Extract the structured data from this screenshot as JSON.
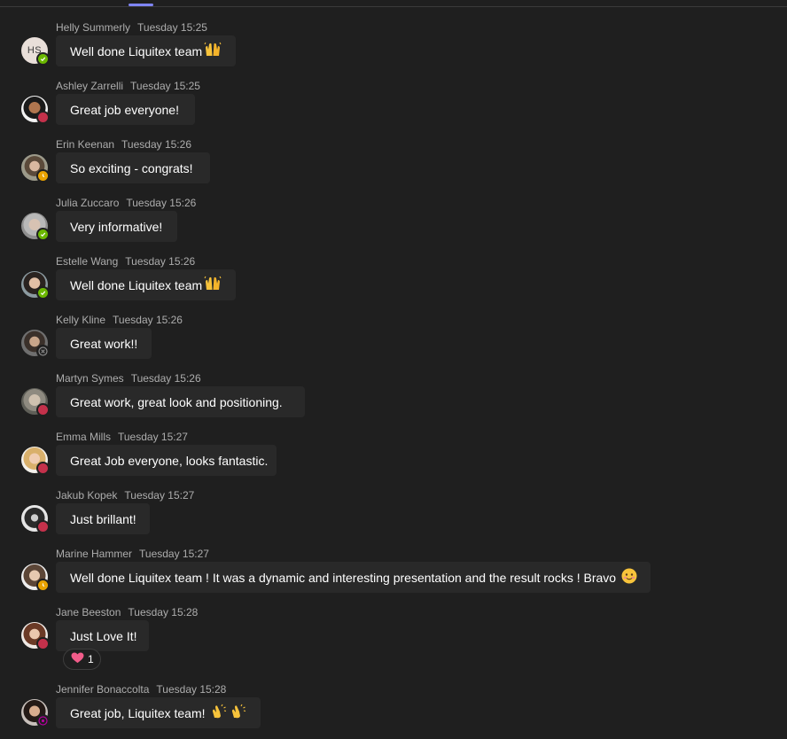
{
  "messages": [
    {
      "author": "Helly Summerly",
      "time": "Tuesday 15:25",
      "text": "Well done Liquitex team",
      "avatar_initials": "HS",
      "presence": "available"
    },
    {
      "author": "Ashley Zarrelli",
      "time": "Tuesday 15:25",
      "text": "Great job everyone!",
      "presence": "busy"
    },
    {
      "author": "Erin Keenan",
      "time": "Tuesday 15:26",
      "text": "So exciting - congrats!",
      "presence": "away"
    },
    {
      "author": "Julia Zuccaro",
      "time": "Tuesday 15:26",
      "text": "Very informative!",
      "presence": "available"
    },
    {
      "author": "Estelle Wang",
      "time": "Tuesday 15:26",
      "text": "Well done Liquitex team",
      "presence": "available"
    },
    {
      "author": "Kelly Kline",
      "time": "Tuesday 15:26",
      "text": "Great work!!",
      "presence": "offline"
    },
    {
      "author": "Martyn Symes",
      "time": "Tuesday 15:26",
      "text": "Great work, great look and positioning.",
      "presence": "busy"
    },
    {
      "author": "Emma Mills",
      "time": "Tuesday 15:27",
      "text": "Great Job everyone, looks fantastic.",
      "presence": "busy"
    },
    {
      "author": "Jakub Kopek",
      "time": "Tuesday 15:27",
      "text": "Just brillant!",
      "presence": "busy"
    },
    {
      "author": "Marine Hammer",
      "time": "Tuesday 15:27",
      "text": "Well done Liquitex team ! It was a dynamic and interesting presentation and the result rocks ! Bravo",
      "presence": "away"
    },
    {
      "author": "Jane Beeston",
      "time": "Tuesday 15:28",
      "text": "Just Love It!",
      "presence": "busy",
      "reaction": {
        "icon": "heart-icon",
        "count": "1"
      }
    },
    {
      "author": "Jennifer Bonaccolta",
      "time": "Tuesday 15:28",
      "text": "Great job, Liquitex team!",
      "presence": "out-of-office"
    }
  ],
  "colors": {
    "available": "#6bb700",
    "busy": "#c4314b",
    "away": "#eaa300",
    "offline": "#8a8a8a",
    "out-of-office": "#b4009e",
    "accent": "#7f85f5"
  }
}
